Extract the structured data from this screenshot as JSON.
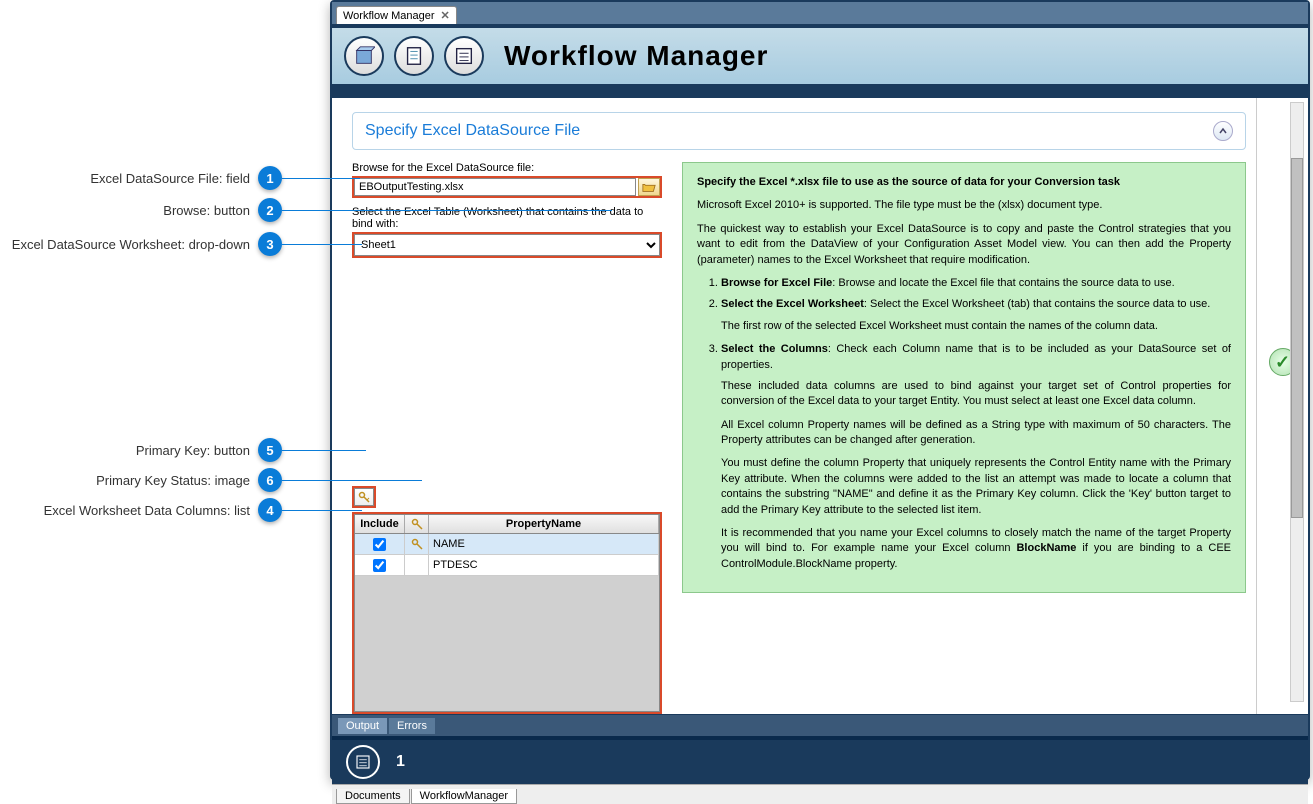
{
  "tab": {
    "label": "Workflow Manager"
  },
  "header": {
    "title": "Workflow Manager"
  },
  "section": {
    "title": "Specify Excel DataSource File"
  },
  "form": {
    "browseLabel": "Browse for the Excel DataSource file:",
    "fileValue": "EBOutputTesting.xlsx",
    "worksheetLabel": "Select the Excel Table (Worksheet) that contains the data to bind with:",
    "worksheetValue": "Sheet1"
  },
  "grid": {
    "headers": {
      "include": "Include",
      "property": "PropertyName"
    },
    "rows": [
      {
        "include": true,
        "isKey": true,
        "property": "NAME"
      },
      {
        "include": true,
        "isKey": false,
        "property": "PTDESC"
      }
    ]
  },
  "help": {
    "title": "Specify the Excel *.xlsx file to use as the source of data for your Conversion task",
    "p1": "Microsoft Excel 2010+ is supported. The file type must be the (xlsx) document type.",
    "p2": "The quickest way to establish your Excel DataSource is to copy and paste the Control strategies that you want to edit from the DataView of your Configuration Asset Model view. You can then add the Property (parameter) names to the Excel Worksheet that require modification.",
    "li1b": "Browse for Excel File",
    "li1": ": Browse and locate the Excel file that contains the source data to use.",
    "li2b": "Select the Excel Worksheet",
    "li2": ": Select the Excel Worksheet (tab) that contains the source data to use.",
    "li2p": "The first row of the selected Excel Worksheet must contain the names of the column data.",
    "li3b": "Select the Columns",
    "li3": ": Check each Column name that is to be included as your DataSource set of properties.",
    "li3p1": "These included data columns are used to bind against your target set of Control properties for conversion of the Excel data to your target Entity. You must select at least one Excel data column.",
    "li3p2": "All Excel column Property names will be defined as a String type with maximum of 50 characters. The Property attributes can be changed after generation.",
    "li3p3": "You must define the column Property that uniquely represents the Control Entity name with the Primary Key attribute. When the columns were added to the list an attempt was made to locate a column that contains the substring \"NAME\" and define it as the Primary Key column. Click the 'Key' button target to add the Primary Key attribute to the selected list item.",
    "li3p4a": "It is recommended that you name your Excel columns to closely match the name of the target Property you will bind to. For example name your Excel column ",
    "li3p4b": "BlockName",
    "li3p4c": " if you are binding to a CEE ControlModule.BlockName property."
  },
  "outputTabs": {
    "output": "Output",
    "errors": "Errors"
  },
  "footer": {
    "page": "1"
  },
  "bottomTabs": {
    "documents": "Documents",
    "workflow": "WorkflowManager"
  },
  "callouts": {
    "c1": "Excel DataSource File: field",
    "c2": "Browse: button",
    "c3": "Excel DataSource Worksheet: drop-down",
    "c4": "Excel Worksheet Data Columns: list",
    "c5": "Primary Key: button",
    "c6": "Primary Key Status: image"
  }
}
